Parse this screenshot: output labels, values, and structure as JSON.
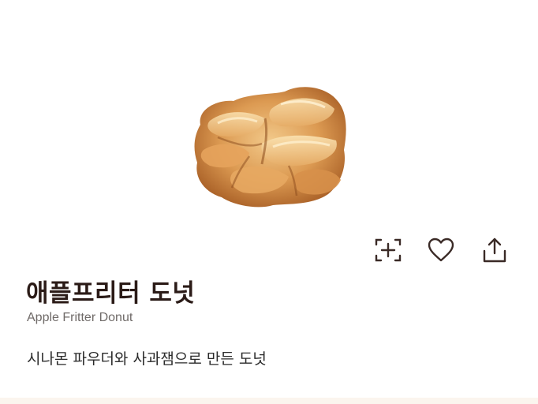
{
  "product": {
    "name_ko": "애플프리터 도넛",
    "name_en": "Apple Fritter Donut",
    "description": "시나몬 파우더와 사과잼으로 만든 도넛",
    "image_alt": "Apple Fritter Donut"
  },
  "actions": [
    {
      "icon": "add-to-search-icon"
    },
    {
      "icon": "heart-icon"
    },
    {
      "icon": "share-icon"
    }
  ],
  "colors": {
    "title": "#2b1b17",
    "subtitle": "#6f6a68",
    "icon": "#3a2a26"
  }
}
